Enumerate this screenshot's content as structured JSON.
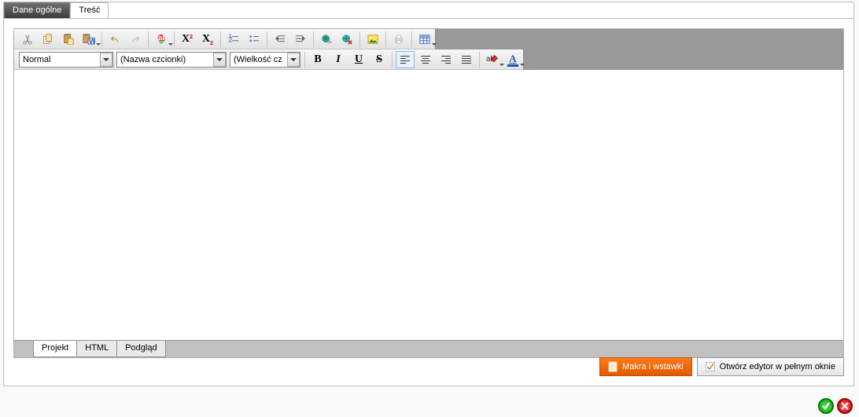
{
  "tabs": {
    "t0": "Dane ogólne",
    "t1": "Treść"
  },
  "row2": {
    "style": "Normal",
    "font": "(Nazwa czcionki)",
    "size": "(Wielkość cz"
  },
  "bottomTabs": {
    "b0": "Projekt",
    "b1": "HTML",
    "b2": "Podgląd"
  },
  "buttons": {
    "macros": "Makra i wstawki",
    "fullscreen": "Otwórz edytor w pełnym oknie"
  }
}
